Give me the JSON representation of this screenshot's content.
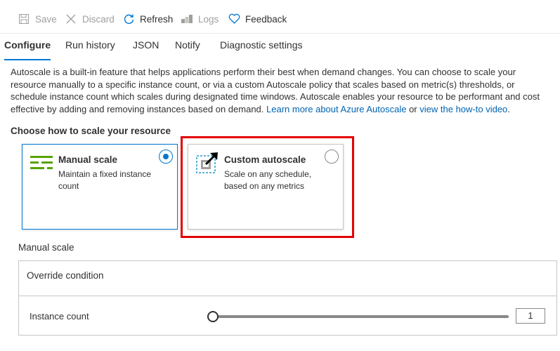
{
  "toolbar": {
    "save": "Save",
    "discard": "Discard",
    "refresh": "Refresh",
    "logs": "Logs",
    "feedback": "Feedback"
  },
  "tabs": [
    "Configure",
    "Run history",
    "JSON",
    "Notify",
    "Diagnostic settings"
  ],
  "description": {
    "text": "Autoscale is a built-in feature that helps applications perform their best when demand changes. You can choose to scale your resource manually to a specific instance count, or via a custom Autoscale policy that scales based on metric(s) thresholds, or schedule instance count which scales during designated time windows. Autoscale enables your resource to be performant and cost effective by adding and removing instances based on demand. ",
    "link1": "Learn more about Azure Autoscale",
    "or": " or ",
    "link2": "view the how-to video",
    "end": "."
  },
  "section_title": "Choose how to scale your resource",
  "options": {
    "manual": {
      "title": "Manual scale",
      "subtitle": "Maintain a fixed instance count",
      "selected": true
    },
    "custom": {
      "title": "Custom autoscale",
      "subtitle": "Scale on any schedule, based on any metrics",
      "selected": false
    }
  },
  "manual_section": {
    "label": "Manual scale",
    "override_condition": "Override condition",
    "instance_count_label": "Instance count",
    "instance_count": "1"
  },
  "colors": {
    "accent": "#0078d4",
    "highlight": "#e30000",
    "manual_icon": "#57a300"
  }
}
